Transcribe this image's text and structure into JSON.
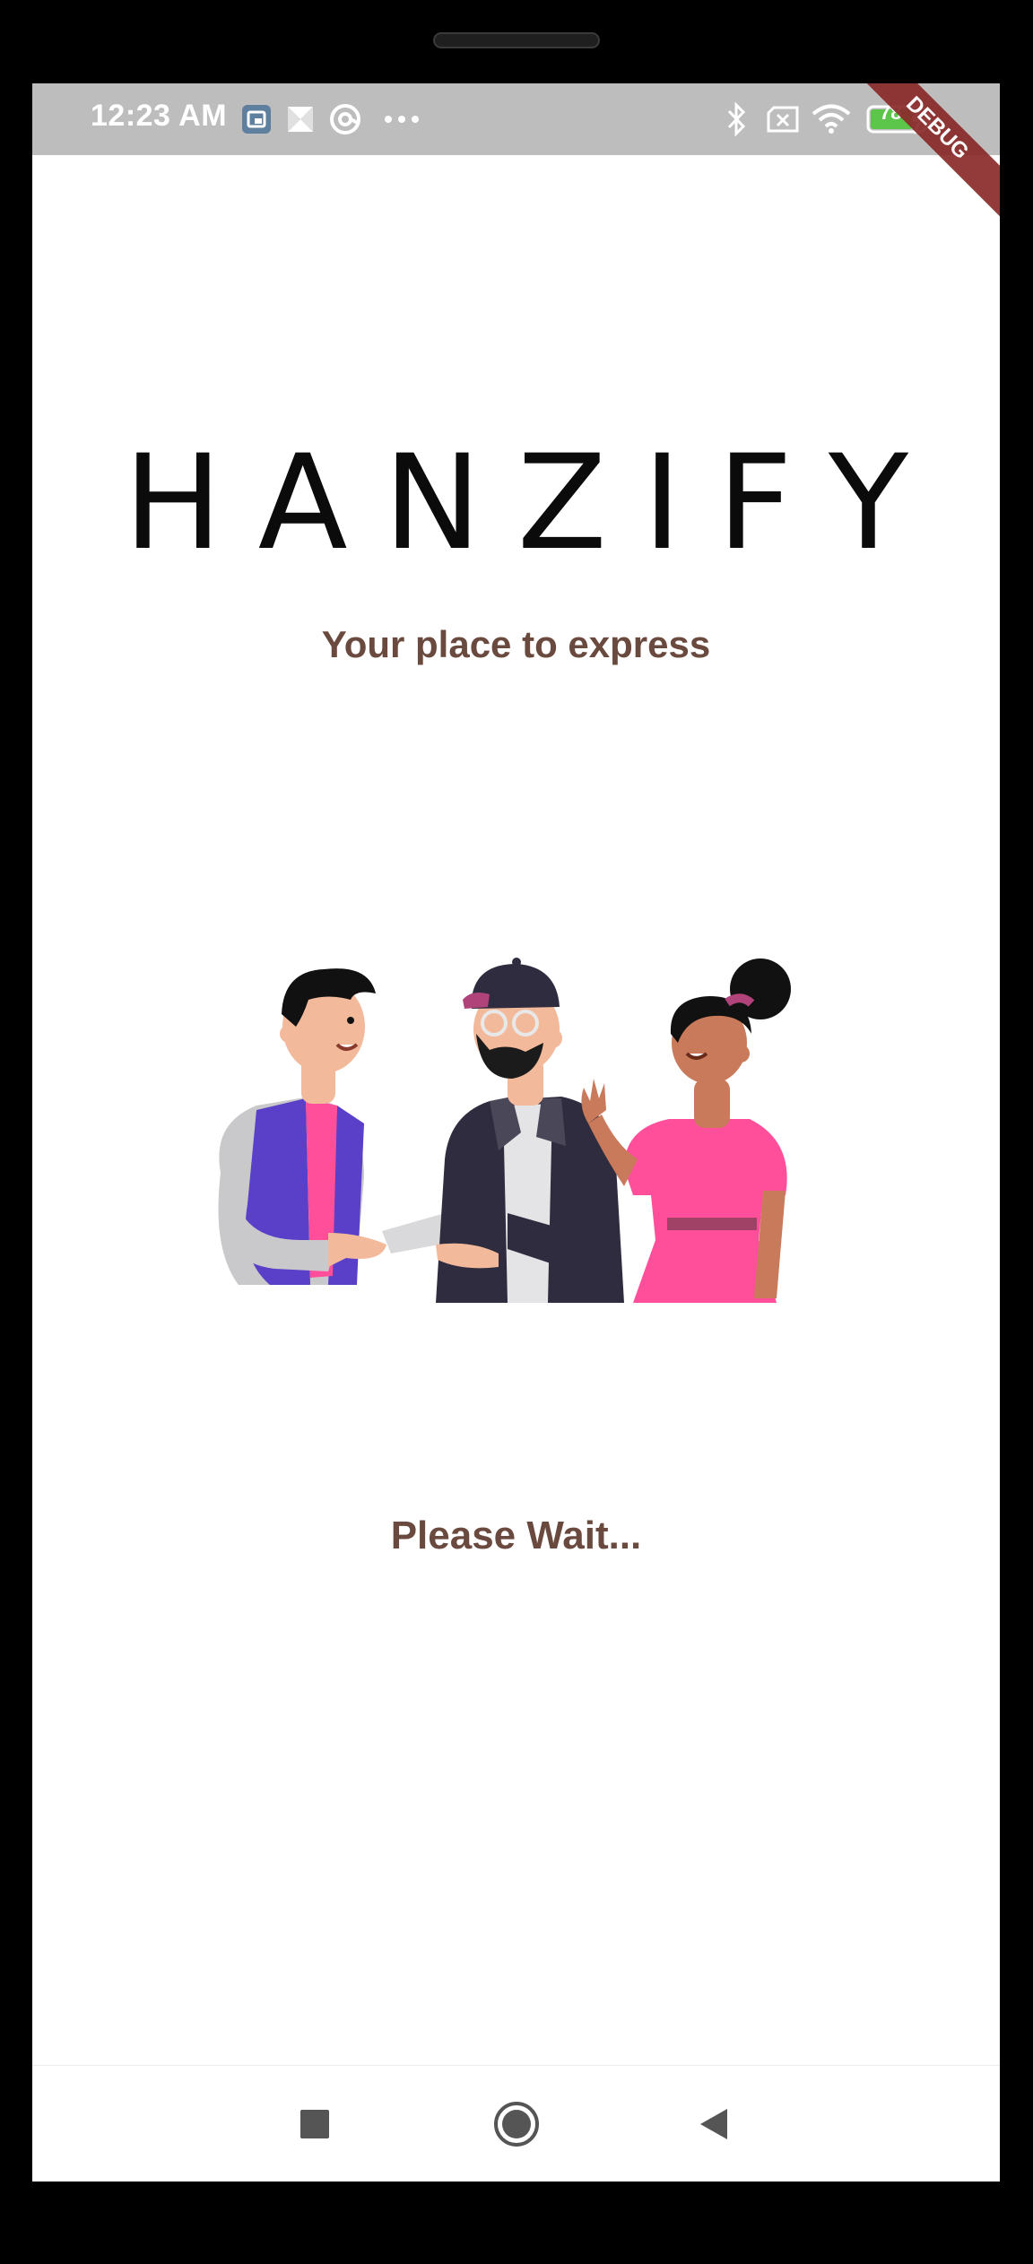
{
  "status_bar": {
    "time": "12:23 AM",
    "battery_level": "78",
    "debug_label": "DEBUG",
    "icons": [
      "gallery-notification-icon",
      "pinwheel-icon",
      "at-sign-icon",
      "more-dots-icon",
      "bluetooth-icon",
      "sim-off-icon",
      "wifi-icon",
      "battery-icon"
    ]
  },
  "app": {
    "brand": "HANZIFY",
    "tagline": "Your place to express",
    "loading_text": "Please Wait..."
  },
  "illustration": {
    "subject": "three friends chatting"
  },
  "nav": {
    "icons": [
      "recents-square-icon",
      "home-circle-icon",
      "back-triangle-icon"
    ]
  },
  "colors": {
    "accent_brown": "#6a4a3e",
    "status_bar_bg": "#bdbdbd",
    "pink": "#ff4f9b",
    "purple": "#5a3fc8",
    "navy": "#2e2c3e"
  }
}
